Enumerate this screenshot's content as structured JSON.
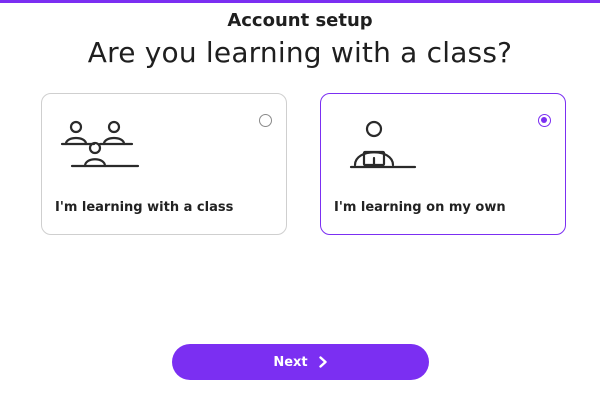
{
  "header": {
    "subtitle": "Account setup",
    "question": "Are you learning with a class?"
  },
  "options": [
    {
      "label": "I'm learning with a class",
      "selected": false,
      "icon": "class-illustration-icon"
    },
    {
      "label": "I'm learning on my own",
      "selected": true,
      "icon": "solo-learner-illustration-icon"
    }
  ],
  "footer": {
    "next_label": "Next",
    "next_icon": "chevron-right-icon"
  },
  "colors": {
    "accent": "#7b2ff2",
    "card_border": "#cfcfcf",
    "text": "#222222"
  }
}
